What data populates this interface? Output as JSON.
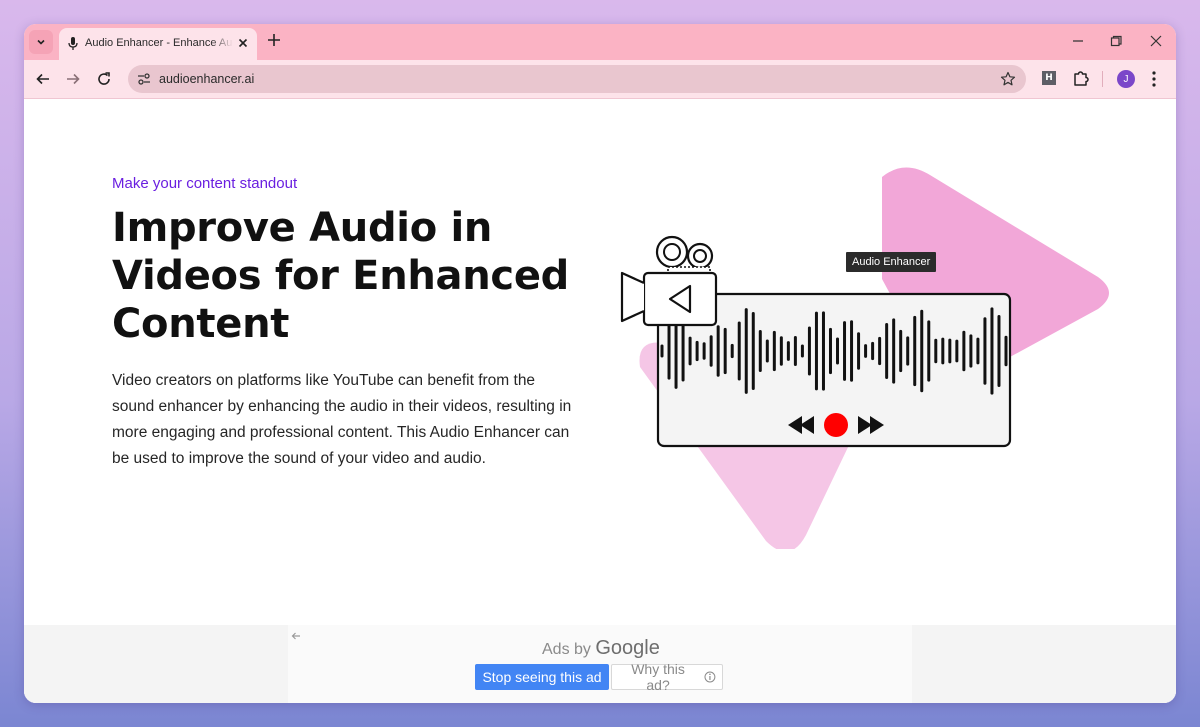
{
  "browser": {
    "tab": {
      "title": "Audio Enhancer - Enhance Audio"
    },
    "omnibox": {
      "url": "audioenhancer.ai"
    },
    "profile": {
      "initial": "J"
    },
    "extension": {
      "label": "H"
    }
  },
  "hero": {
    "eyebrow": "Make your content standout",
    "headline": "Improve Audio in Videos for Enhanced Content",
    "body": "Video creators on platforms like YouTube can benefit from the sound enhancer by enhancing the audio in their videos, resulting in more engaging and professional content. This Audio Enhancer can be used to improve the sound of your video and audio.",
    "tooltip": "Audio Enhancer"
  },
  "ad": {
    "ads_by": "Ads by",
    "google": "Google",
    "stop_label": "Stop seeing this ad",
    "why_label": "Why this ad?"
  },
  "colors": {
    "tabstrip": "#fbb3c4",
    "toolbar": "#fde3ea",
    "accent_purple": "#6a1fe0",
    "triangle_pink": "#f2a7d8",
    "record_red": "#ff0000",
    "ad_blue": "#4285f4"
  },
  "icons": [
    "mic-icon",
    "search-tabs-icon",
    "close-icon",
    "plus-icon",
    "back-icon",
    "forward-icon",
    "reload-icon",
    "site-info-icon",
    "star-icon",
    "puzzle-icon",
    "kebab-icon",
    "info-icon"
  ]
}
